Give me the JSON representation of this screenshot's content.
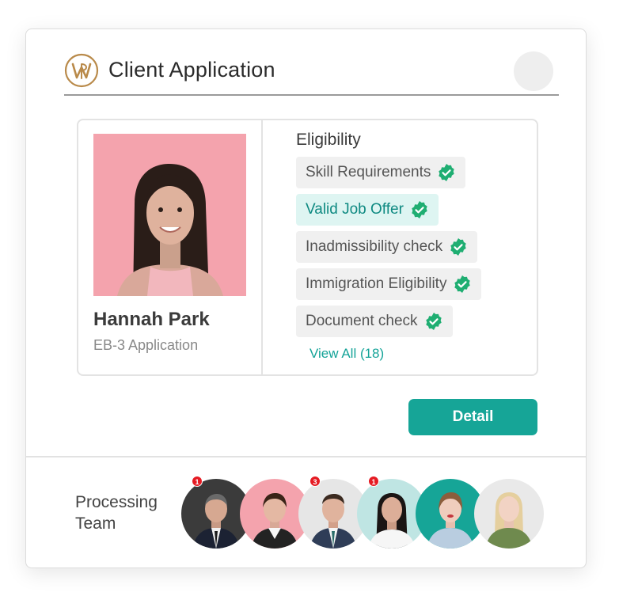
{
  "header": {
    "title": "Client Application",
    "logo_icon": "wp-monogram-logo"
  },
  "applicant": {
    "name": "Hannah Park",
    "application": "EB-3 Application"
  },
  "eligibility": {
    "title": "Eligibility",
    "items": [
      {
        "label": "Skill Requirements",
        "status": "verified",
        "active": false
      },
      {
        "label": "Valid Job Offer",
        "status": "verified",
        "active": true
      },
      {
        "label": "Inadmissibility check",
        "status": "verified",
        "active": false
      },
      {
        "label": "Immigration Eligibility",
        "status": "verified",
        "active": false
      },
      {
        "label": "Document check",
        "status": "verified",
        "active": false
      }
    ],
    "view_all": "View All (18)"
  },
  "actions": {
    "detail_label": "Detail"
  },
  "team": {
    "label": "Processing Team",
    "members": [
      {
        "bg": "#3b3b3b",
        "notifications": "1"
      },
      {
        "bg": "#f4a3ad",
        "notifications": ""
      },
      {
        "bg": "#e6e6e6",
        "notifications": "3"
      },
      {
        "bg": "#bfe5e3",
        "notifications": "1"
      },
      {
        "bg": "#16a597",
        "notifications": ""
      },
      {
        "bg": "#e9e9e9",
        "notifications": ""
      }
    ]
  },
  "colors": {
    "accent": "#16a597",
    "chip_active_bg": "#def5f2",
    "notification": "#e51b23",
    "logo": "#b98a4a"
  }
}
